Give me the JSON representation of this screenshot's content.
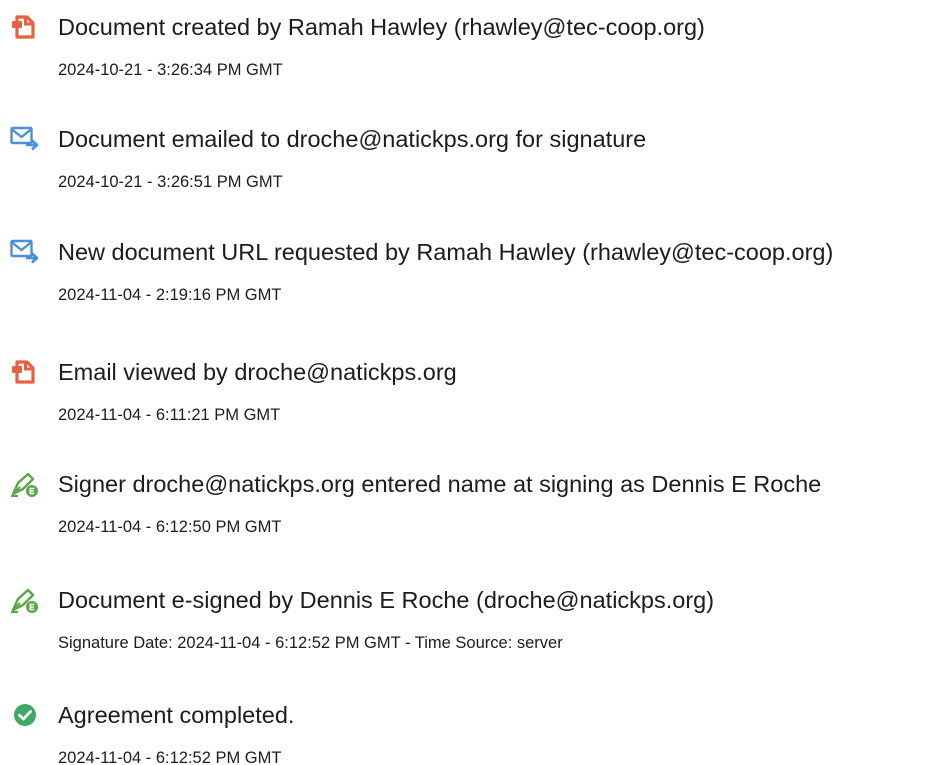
{
  "events": [
    {
      "icon": "document-created-icon",
      "title": "Document created by Ramah Hawley (rhawley@tec-coop.org)",
      "meta": "2024-10-21 - 3:26:34 PM GMT"
    },
    {
      "icon": "email-sent-icon",
      "title": "Document emailed to droche@natickps.org for signature",
      "meta": "2024-10-21 - 3:26:51 PM GMT"
    },
    {
      "icon": "email-sent-icon",
      "title": "New document URL requested by Ramah Hawley (rhawley@tec-coop.org)",
      "meta": "2024-11-04 - 2:19:16 PM GMT"
    },
    {
      "icon": "document-viewed-icon",
      "title": "Email viewed by droche@natickps.org",
      "meta": "2024-11-04 - 6:11:21 PM GMT"
    },
    {
      "icon": "esign-pen-icon",
      "title": "Signer droche@natickps.org entered name at signing as Dennis E Roche",
      "meta": "2024-11-04 - 6:12:50 PM GMT"
    },
    {
      "icon": "esign-pen-icon",
      "title": "Document e-signed by Dennis E Roche (droche@natickps.org)",
      "meta": "Signature Date: 2024-11-04 - 6:12:52 PM GMT - Time Source: server"
    },
    {
      "icon": "check-circle-icon",
      "title": "Agreement completed.",
      "meta": "2024-11-04 - 6:12:52 PM GMT"
    }
  ],
  "colors": {
    "document_orange": "#e8613c",
    "email_blue": "#4a8fd8",
    "esign_green": "#5aa64a",
    "check_green": "#3ea864"
  }
}
